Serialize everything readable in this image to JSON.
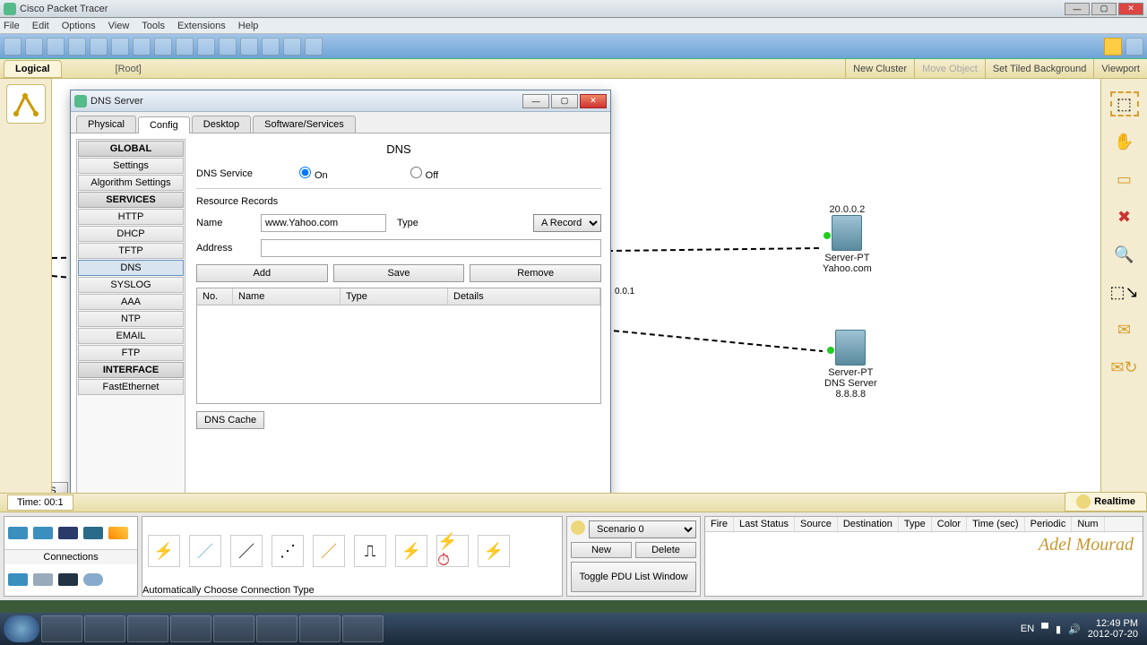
{
  "window": {
    "title": "Cisco Packet Tracer"
  },
  "menu": {
    "file": "File",
    "edit": "Edit",
    "options": "Options",
    "view": "View",
    "tools": "Tools",
    "extensions": "Extensions",
    "help": "Help"
  },
  "viewbar": {
    "logical": "Logical",
    "root": "[Root]",
    "newcluster": "New Cluster",
    "moveobj": "Move Object",
    "tiled": "Set Tiled Background",
    "viewport": "Viewport"
  },
  "timebar": {
    "time": "Time: 00:1",
    "realtime": "Realtime"
  },
  "statusbtn": "DNS S",
  "dialog": {
    "title": "DNS Server",
    "tabs": {
      "physical": "Physical",
      "config": "Config",
      "desktop": "Desktop",
      "software": "Software/Services"
    },
    "sidebar": {
      "global": "GLOBAL",
      "settings": "Settings",
      "algo": "Algorithm Settings",
      "services": "SERVICES",
      "http": "HTTP",
      "dhcp": "DHCP",
      "tftp": "TFTP",
      "dns": "DNS",
      "syslog": "SYSLOG",
      "aaa": "AAA",
      "ntp": "NTP",
      "email": "EMAIL",
      "ftp": "FTP",
      "interface": "INTERFACE",
      "fasteth": "FastEthernet"
    },
    "panel": {
      "heading": "DNS",
      "service_label": "DNS Service",
      "on": "On",
      "off": "Off",
      "rr": "Resource Records",
      "name_label": "Name",
      "name_value": "www.Yahoo.com",
      "type_label": "Type",
      "type_value": "A Record",
      "addr_label": "Address",
      "addr_value": "",
      "add": "Add",
      "save": "Save",
      "remove": "Remove",
      "cols": {
        "no": "No.",
        "name": "Name",
        "type": "Type",
        "details": "Details"
      },
      "cache": "DNS Cache"
    }
  },
  "topology": {
    "yahoo": {
      "ip": "20.0.0.2",
      "line1": "Server-PT",
      "line2": "Yahoo.com"
    },
    "dns": {
      "line1": "Server-PT",
      "line2": "DNS Server",
      "ip": "8.8.8.8"
    },
    "midip": "0.0.1"
  },
  "devpanel": {
    "connections": "Connections",
    "autoconn": "Automatically Choose Connection Type"
  },
  "scenario": {
    "label": "Scenario 0",
    "new": "New",
    "delete": "Delete",
    "toggle": "Toggle PDU List Window"
  },
  "pdu_headers": {
    "fire": "Fire",
    "last": "Last Status",
    "src": "Source",
    "dst": "Destination",
    "type": "Type",
    "color": "Color",
    "time": "Time (sec)",
    "periodic": "Periodic",
    "num": "Num"
  },
  "signature": "Adel Mourad",
  "tray": {
    "lang": "EN",
    "time": "12:49 PM",
    "date": "2012-07-20"
  }
}
